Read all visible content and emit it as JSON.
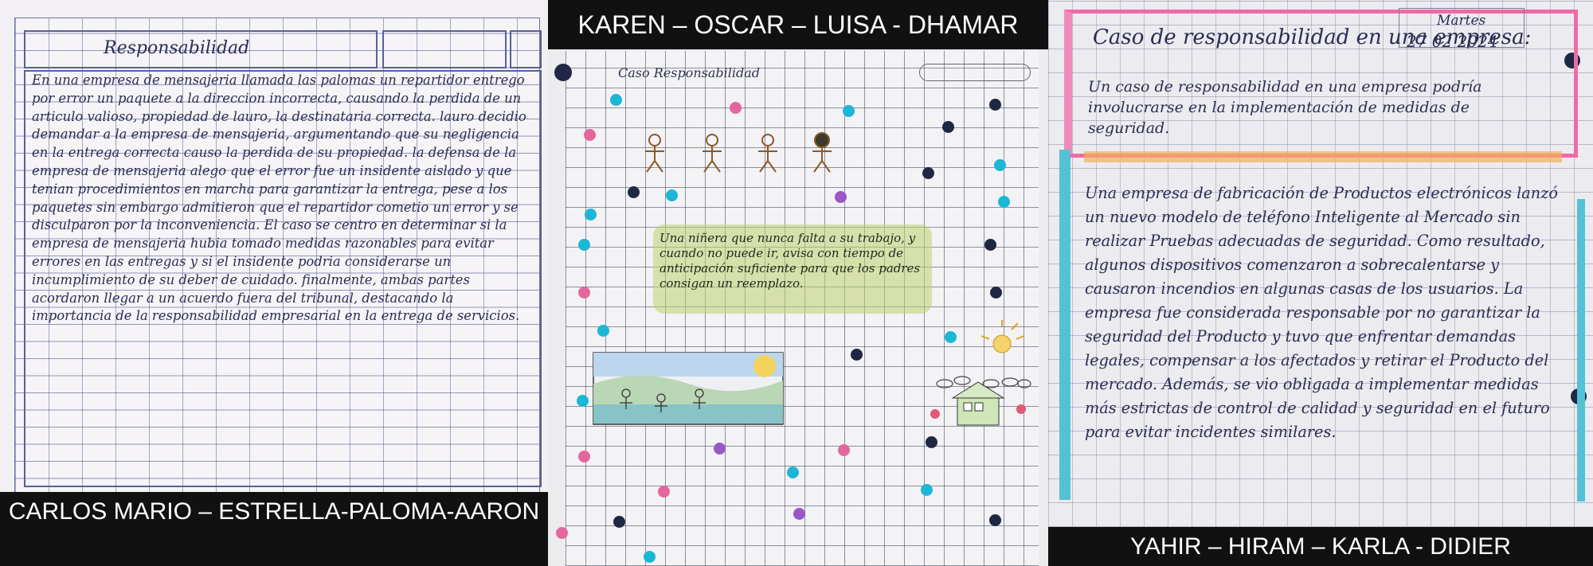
{
  "panels": [
    {
      "title": "Responsabilidad",
      "text": "En una empresa de mensajeria llamada las palomas un repartidor entrego por error un paquete a la direccion incorrecta, causando la perdida de un articulo valioso, propiedad de lauro, la destinataria correcta. lauro decidio demandar a la empresa de mensajeria, argumentando que su negligencia en la entrega correcta causo la perdida de su propiedad. la defensa de la empresa de mensajeria alego que el error fue un insidente aislado y que tenian procedimientos en marcha para garantizar la entrega, pese a los paquetes sin embargo admitieron que el repartidor cometio un error y se disculparon por la inconveniencia. El caso se centro en determinar si la empresa de mensajeria hubia tomado medidas razonables para evitar errores en las entregas y si el insidente podria considerarse un incumplimiento de su deber de cuidado. finalmente, ambas partes acordaron llegar a un acuerdo fuera del tribunal, destacando la importancia de la responsabilidad empresarial en la entrega de servicios.",
      "caption": "CARLOS MARIO – ESTRELLA-PALOMA-AARON"
    },
    {
      "header": "KAREN – OSCAR – LUISA - DHAMAR",
      "title": "Caso Responsabilidad",
      "text": "Una niñera que nunca falta a su trabajo, y cuando no puede ir, avisa con tiempo de anticipación suficiente para que los padres consigan un reemplazo."
    },
    {
      "day": "Martes",
      "date": "27 02 2024",
      "title": "Caso de responsabilidad en una empresa:",
      "intro": "Un caso de responsabilidad en una empresa podría involucrarse en la implementación de medidas de seguridad.",
      "text": "Una empresa de fabricación de Productos electrónicos lanzó un nuevo modelo de teléfono Inteligente al Mercado sin realizar Pruebas adecuadas de seguridad. Como resultado, algunos dispositivos comenzaron a sobrecalentarse y causaron incendios en algunas casas de los usuarios. La empresa fue considerada responsable por no garantizar la seguridad del Producto y tuvo que enfrentar demandas legales, compensar a los afectados y retirar el Producto del mercado. Además, se vio obligada a implementar medidas más estrictas de control de calidad y seguridad en el futuro para evitar incidentes similares.",
      "caption": "YAHIR – HIRAM – KARLA - DIDIER"
    }
  ],
  "colors": {
    "ink": "#2a2d52",
    "highlight_pink": "#ef6aa8",
    "highlight_orange": "#f4b05b",
    "highlight_blue": "#53c2d6",
    "highlight_green": "#bed26e",
    "dot_cyan": "#1cb7d6",
    "dot_pink": "#e4679c",
    "dot_navy": "#1e2845"
  }
}
